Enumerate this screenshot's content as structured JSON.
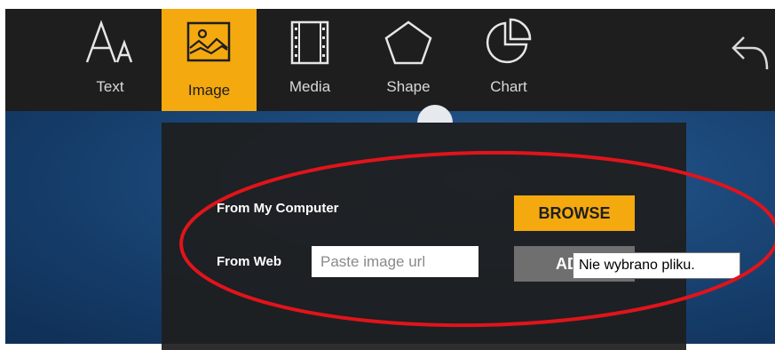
{
  "toolbar": {
    "tools": [
      {
        "id": "text",
        "label": "Text",
        "icon": "text-size-icon",
        "active": false
      },
      {
        "id": "image",
        "label": "Image",
        "icon": "image-icon",
        "active": true
      },
      {
        "id": "media",
        "label": "Media",
        "icon": "film-icon",
        "active": false
      },
      {
        "id": "shape",
        "label": "Shape",
        "icon": "pentagon-icon",
        "active": false
      },
      {
        "id": "chart",
        "label": "Chart",
        "icon": "pie-chart-icon",
        "active": false
      }
    ],
    "undo_icon": "undo-icon",
    "active_color": "#f4a90f",
    "bar_color": "#1e1e1e"
  },
  "image_panel": {
    "from_computer_label": "From My Computer",
    "browse_label": "BROWSE",
    "from_web_label": "From Web",
    "url_placeholder": "Paste image url",
    "add_label": "ADD",
    "tooltip": "Nie wybrano pliku.",
    "highlight_color": "#e0141b"
  }
}
